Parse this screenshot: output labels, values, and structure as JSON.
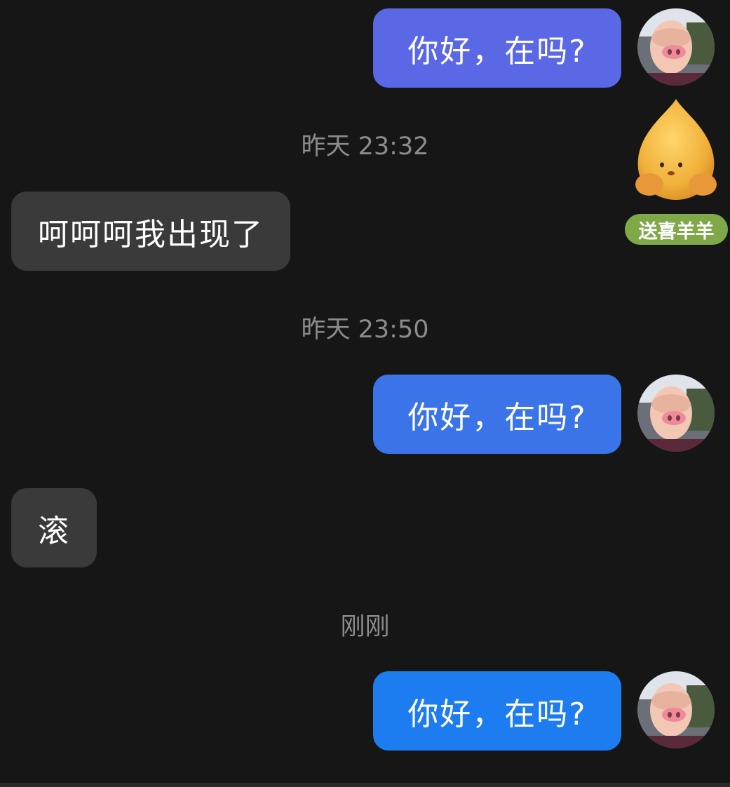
{
  "messages": [
    {
      "side": "out",
      "text": "你好，在吗?",
      "color": "#5a68e6"
    },
    {
      "timestamp": "昨天 23:32"
    },
    {
      "side": "in",
      "text": "呵呵呵我出现了"
    },
    {
      "timestamp": "昨天 23:50"
    },
    {
      "side": "out",
      "text": "你好，在吗?",
      "color": "#3a74e8"
    },
    {
      "side": "in",
      "text": "滚"
    },
    {
      "timestamp": "刚刚"
    },
    {
      "side": "out",
      "text": "你好，在吗?",
      "color": "#1d7df0"
    }
  ],
  "gift": {
    "label": "送喜羊羊",
    "icon": "peach-mascot-icon"
  },
  "avatar": {
    "icon": "pig-face-avatar"
  }
}
